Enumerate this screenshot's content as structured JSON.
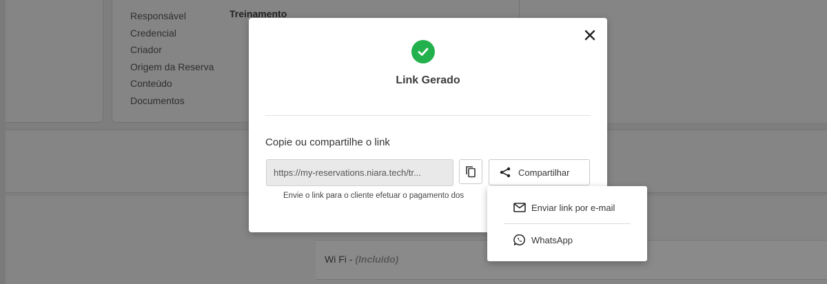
{
  "background": {
    "labels": [
      "Responsável",
      "Credencial",
      "Criador",
      "Origem da Reserva",
      "Conteúdo",
      "Documentos"
    ],
    "responsavel_value": "Treinamento",
    "amenity_name": "Wi Fi",
    "amenity_separator": " - ",
    "amenity_status": "(Incluído)"
  },
  "modal": {
    "title": "Link Gerado",
    "copy_label": "Copie ou compartilhe o link",
    "link_value": "https://my-reservations.niara.tech/tr...",
    "share_label": "Compartilhar",
    "help_text": "Envie o link para o cliente efetuar o pagamento dos"
  },
  "share_menu": {
    "email_label": "Enviar link por e-mail",
    "whatsapp_label": "WhatsApp"
  },
  "colors": {
    "success": "#22b14c",
    "overlay": "#7e7e7e"
  },
  "icons": [
    "close-icon",
    "check-icon",
    "copy-icon",
    "share-icon",
    "mail-icon",
    "whatsapp-icon"
  ]
}
